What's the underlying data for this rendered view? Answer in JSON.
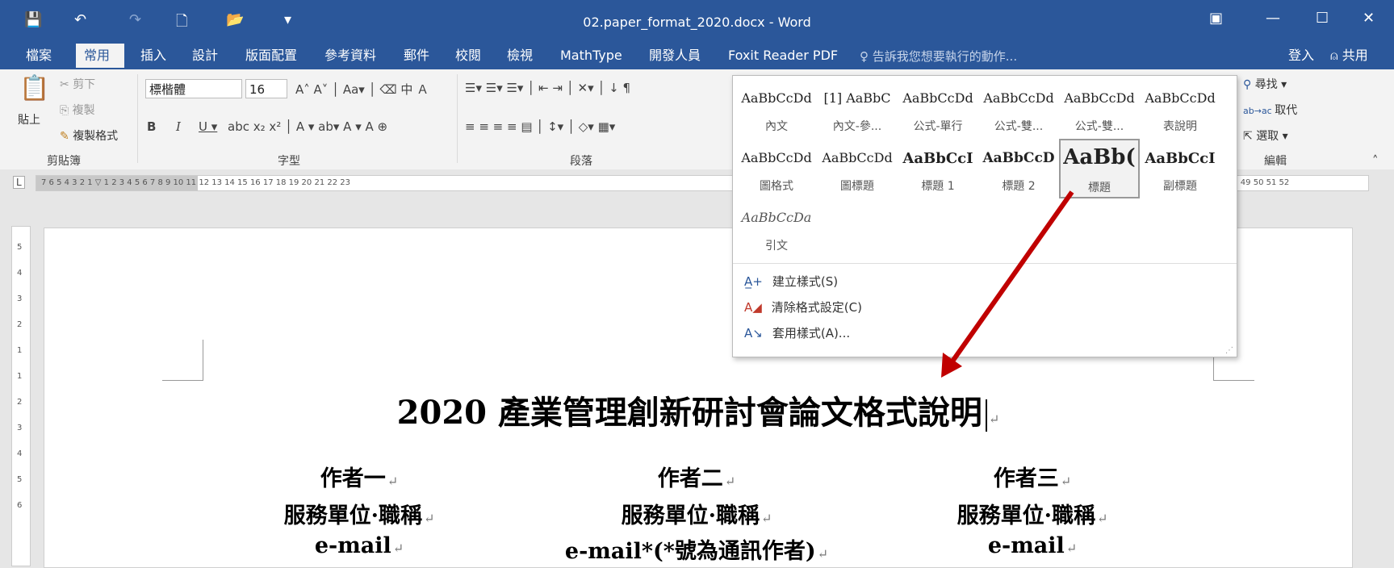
{
  "window": {
    "title": "02.paper_format_2020.docx - Word",
    "controls": {
      "ribbon_display": "▣",
      "minimize": "—",
      "maximize": "☐",
      "close": "✕"
    }
  },
  "quick_access": {
    "save": "💾",
    "undo": "↶",
    "redo": "↷",
    "new": "🗋",
    "open": "📂",
    "customize": "▾"
  },
  "tabs": [
    {
      "label": "檔案"
    },
    {
      "label": "常用"
    },
    {
      "label": "插入"
    },
    {
      "label": "設計"
    },
    {
      "label": "版面配置"
    },
    {
      "label": "參考資料"
    },
    {
      "label": "郵件"
    },
    {
      "label": "校閱"
    },
    {
      "label": "檢視"
    },
    {
      "label": "MathType"
    },
    {
      "label": "開發人員"
    },
    {
      "label": "Foxit Reader PDF"
    }
  ],
  "tell_me": "告訴我您想要執行的動作...",
  "account": {
    "signin": "登入",
    "share": "共用"
  },
  "ribbon": {
    "clipboard": {
      "paste": "貼上",
      "cut": "剪下",
      "copy": "複製",
      "format_painter": "複製格式",
      "label": "剪貼簿"
    },
    "font": {
      "name": "標楷體",
      "size": "16",
      "label": "字型"
    },
    "paragraph": {
      "label": "段落"
    },
    "editing": {
      "find": "尋找",
      "replace": "取代",
      "select": "選取",
      "label": "編輯"
    }
  },
  "style_gallery": {
    "rows": [
      [
        {
          "preview": "AaBbCcDd",
          "name": "內文"
        },
        {
          "preview": "[1] AaBbC",
          "name": "內文-參..."
        },
        {
          "preview": "AaBbCcDd",
          "name": "公式-單行"
        },
        {
          "preview": "AaBbCcDd",
          "name": "公式-雙..."
        },
        {
          "preview": "AaBbCcDd",
          "name": "公式-雙..."
        },
        {
          "preview": "AaBbCcDd",
          "name": "表說明"
        }
      ],
      [
        {
          "preview": "AaBbCcDd",
          "name": "圖格式"
        },
        {
          "preview": "AaBbCcDd",
          "name": "圖標題"
        },
        {
          "preview": "AaBbCcI",
          "name": "標題 1"
        },
        {
          "preview": "AaBbCcD",
          "name": "標題 2"
        },
        {
          "preview": "AaBb(",
          "name": "標題"
        },
        {
          "preview": "AaBbCcI",
          "name": "副標題"
        }
      ],
      [
        {
          "preview": "AaBbCcDa",
          "name": "引文"
        }
      ]
    ],
    "commands": [
      {
        "label": "建立樣式(S)"
      },
      {
        "label": "清除格式設定(C)"
      },
      {
        "label": "套用樣式(A)..."
      }
    ]
  },
  "ruler": {
    "horizontal": "7 6 5 4 3 2 1 ▽ 1 2 3 4 5 6 7 8 9 10 11 12 13 14 15 16 17 18 19 20 21 22 23",
    "horizontal_right": "47 48 49 50 51 52",
    "vertical": "5 4 3 2 1 1 2 3 4 5 6"
  },
  "document": {
    "heading": "2020 產業管理創新研討會論文格式說明",
    "authors": [
      {
        "name": "作者一",
        "affiliation": "服務單位·職稱",
        "email": "e-mail"
      },
      {
        "name": "作者二",
        "affiliation": "服務單位·職稱",
        "email": "e-mail*(*號為通訊作者)"
      },
      {
        "name": "作者三",
        "affiliation": "服務單位·職稱",
        "email": "e-mail"
      }
    ]
  },
  "colors": {
    "accent": "#2b579a",
    "arrow": "#c00000"
  }
}
